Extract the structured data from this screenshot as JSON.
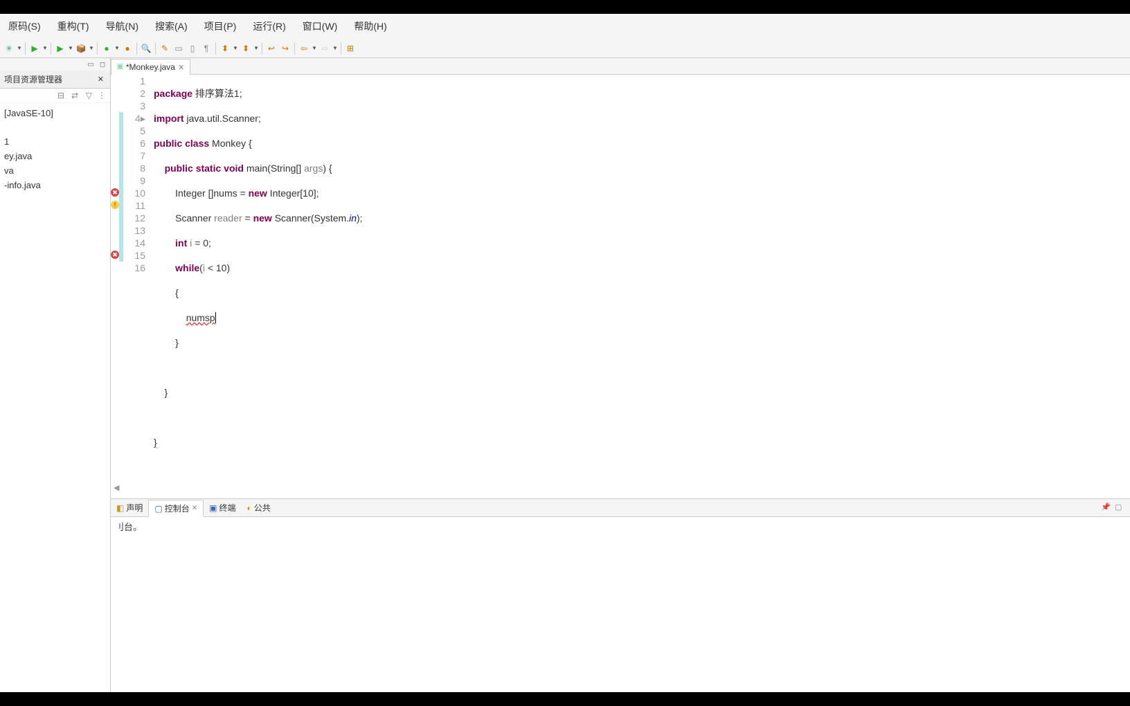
{
  "menu": {
    "source": "原码(S)",
    "refactor": "重构(T)",
    "navigate": "导航(N)",
    "search": "搜索(A)",
    "project": "项目(P)",
    "run": "运行(R)",
    "window": "窗口(W)",
    "help": "帮助(H)"
  },
  "sidebar": {
    "title": "项目资源管理器",
    "jdk": "[JavaSE-10]",
    "items": [
      "1",
      "ey.java",
      "va",
      "-info.java"
    ]
  },
  "editor": {
    "tab_title": "*Monkey.java",
    "lines": {
      "1": "package 排序算法1;",
      "2": "import java.util.Scanner;",
      "3": "public class Monkey {",
      "4": "    public static void main(String[] args) {",
      "5": "        Integer []nums = new Integer[10];",
      "6": "        Scanner reader = new Scanner(System.in);",
      "7": "        int i = 0;",
      "8": "        while(i < 10)",
      "9": "        {",
      "10": "            numsp",
      "11": "        }",
      "12": "",
      "13": "    }",
      "14": "",
      "15": "}",
      "16": ""
    }
  },
  "bottom": {
    "tab_declaration": "声明",
    "tab_console": "控制台",
    "tab_terminal": "终端",
    "tab_public": "公共",
    "console_text": "刂台。"
  }
}
